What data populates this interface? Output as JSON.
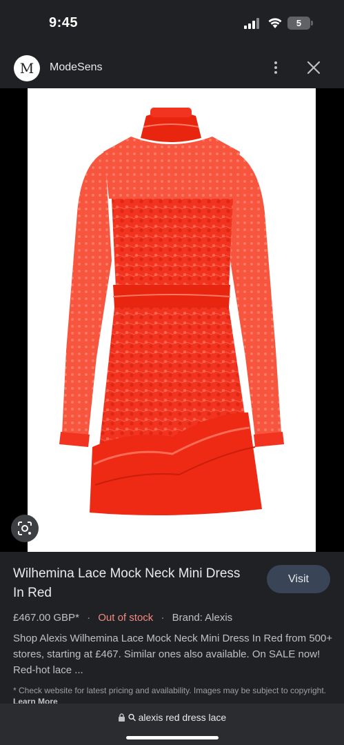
{
  "status_bar": {
    "time": "9:45",
    "battery_level": "5"
  },
  "header": {
    "site_avatar_letter": "M",
    "site_name": "ModeSens"
  },
  "image": {
    "description_icon": "lens-icon"
  },
  "product": {
    "title": "Wilhemina Lace Mock Neck Mini Dress In Red",
    "visit_label": "Visit",
    "price": "£467.00 GBP*",
    "separator": "·",
    "stock_status": "Out of stock",
    "brand": "Brand: Alexis",
    "description": "Shop Alexis Wilhemina Lace Mock Neck Mini Dress In Red from 500+ stores, starting at £467. Similar ones also available. On SALE now! Red-hot lace ...",
    "disclaimer": "* Check website for latest pricing and availability. Images may be subject to copyright.",
    "learn_more": "Learn More"
  },
  "bottom_bar": {
    "search_query": "alexis red dress lace"
  },
  "colors": {
    "background": "#202124",
    "out_of_stock": "#f28b82",
    "visit_button": "#394457",
    "dress_red": "#f2331f"
  }
}
